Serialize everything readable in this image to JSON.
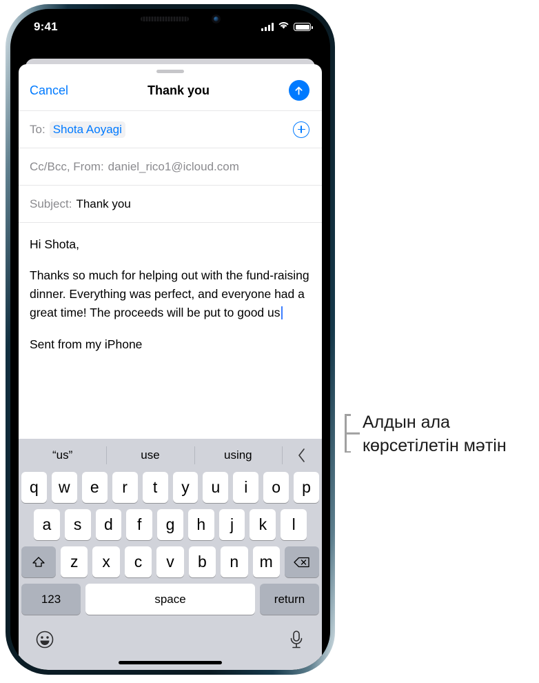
{
  "status_bar": {
    "time": "9:41",
    "signal_icon": "cellular-signal-icon",
    "wifi_icon": "wifi-icon",
    "battery_icon": "battery-full-icon"
  },
  "nav_bar": {
    "cancel_label": "Cancel",
    "title": "Thank you",
    "send_icon": "send-arrow-up-icon"
  },
  "compose": {
    "to_label": "To:",
    "recipient": "Shota Aoyagi",
    "add_recipient_icon": "plus-circle-icon",
    "cc_bcc_from_label": "Cc/Bcc, From:",
    "from_address": "daniel_rico1@icloud.com",
    "subject_label": "Subject:",
    "subject_value": "Thank you",
    "body_paragraphs": [
      "Hi Shota,",
      "Thanks so much for helping out with the fund-raising dinner. Everything was perfect, and everyone had a great time! The proceeds will be put to good us",
      "Sent from my iPhone"
    ]
  },
  "keyboard": {
    "predictions": [
      "“us”",
      "use",
      "using"
    ],
    "collapse_icon": "chevron-left-icon",
    "row1": [
      "q",
      "w",
      "e",
      "r",
      "t",
      "y",
      "u",
      "i",
      "o",
      "p"
    ],
    "row2": [
      "a",
      "s",
      "d",
      "f",
      "g",
      "h",
      "j",
      "k",
      "l"
    ],
    "row3": [
      "z",
      "x",
      "c",
      "v",
      "b",
      "n",
      "m"
    ],
    "shift_icon": "shift-arrow-up-icon",
    "backspace_icon": "backspace-delete-icon",
    "numbers_label": "123",
    "space_label": "space",
    "return_label": "return",
    "emoji_icon": "emoji-smiley-icon",
    "dictation_icon": "microphone-icon"
  },
  "callout": {
    "text": "Алдын ала көрсетілетін мәтін"
  },
  "colors": {
    "accent_blue": "#007aff",
    "keyboard_bg": "#d1d3da",
    "key_dark": "#aeb3bd"
  }
}
